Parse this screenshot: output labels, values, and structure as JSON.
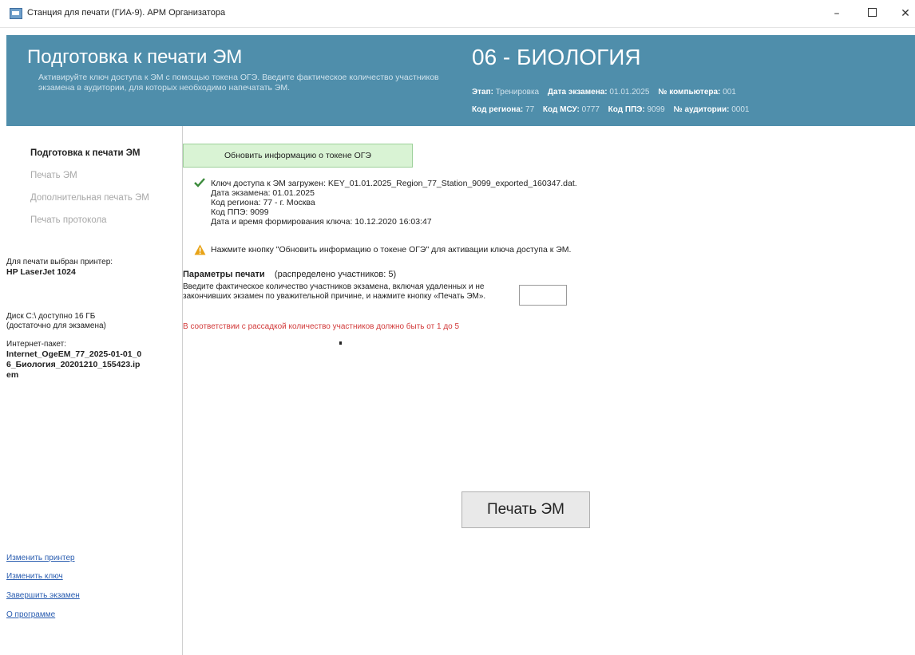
{
  "window": {
    "title": "Станция для печати (ГИА-9). АРМ Организатора",
    "minimize_glyph": "–",
    "close_glyph": "✕"
  },
  "header": {
    "title": "Подготовка к печати ЭМ",
    "subtitle": "Активируйте ключ доступа к ЭМ с помощью токена ОГЭ. Введите фактическое количество участников экзамена в аудитории, для которых необходимо напечатать ЭМ.",
    "subject": "06 - БИОЛОГИЯ",
    "info": {
      "stage_label": "Этап:",
      "stage_value": "Тренировка",
      "exam_date_label": "Дата экзамена:",
      "exam_date_value": "01.01.2025",
      "computer_label": "№ компьютера:",
      "computer_value": "001",
      "region_label": "Код региона:",
      "region_value": "77",
      "msu_label": "Код МСУ:",
      "msu_value": "0777",
      "ppe_label": "Код ППЭ:",
      "ppe_value": "9099",
      "auditorium_label": "№ аудитории:",
      "auditorium_value": "0001"
    }
  },
  "sidebar": {
    "nav": [
      {
        "label": "Подготовка к печати ЭМ",
        "active": true
      },
      {
        "label": "Печать ЭМ",
        "active": false
      },
      {
        "label": "Дополнительная печать ЭМ",
        "active": false
      },
      {
        "label": "Печать протокола",
        "active": false
      }
    ],
    "printer_label": "Для печати выбран принтер:",
    "printer_name": "HP LaserJet 1024",
    "disk_line1": "Диск C:\\ доступно 16 ГБ",
    "disk_line2": "(достаточно для экзамена)",
    "package_label": "Интернет-пакет:",
    "package_name": "Internet_OgeEM_77_2025-01-01_06_Биология_20201210_155423.ipem",
    "links": [
      "Изменить принтер",
      "Изменить ключ",
      "Завершить экзамен",
      "О программе"
    ]
  },
  "main": {
    "refresh_button": "Обновить информацию о токене ОГЭ",
    "key": {
      "loaded": "Ключ доступа к ЭМ загружен: KEY_01.01.2025_Region_77_Station_9099_exported_160347.dat.",
      "exam_date": "Дата экзамена: 01.01.2025",
      "region": "Код региона: 77 - г. Москва",
      "ppe": "Код ППЭ: 9099",
      "generated": "Дата и время формирования ключа: 10.12.2020 16:03:47"
    },
    "warning": "Нажмите кнопку \"Обновить информацию о токене ОГЭ\" для активации ключа доступа к ЭМ.",
    "params": {
      "title": "Параметры печати",
      "distributed": "(распределено участников: 5)",
      "description": "Введите фактическое количество участников экзамена, включая удаленных и не закончивших экзамен по уважительной причине, и нажмите кнопку «Печать ЭМ».",
      "error": "В соответствии с рассадкой количество участников должно быть от 1 до 5",
      "count_value": ""
    },
    "print_button": "Печать ЭМ"
  },
  "colors": {
    "header_bg": "#4f8eab",
    "refresh_bg": "#d9f3d4",
    "error_text": "#d23a3a",
    "link": "#2a5db0",
    "check": "#3a8a3a",
    "warning": "#e8a317"
  },
  "icons": [
    "app-icon",
    "minimize-icon",
    "maximize-icon",
    "close-icon",
    "check-icon",
    "warning-icon"
  ]
}
